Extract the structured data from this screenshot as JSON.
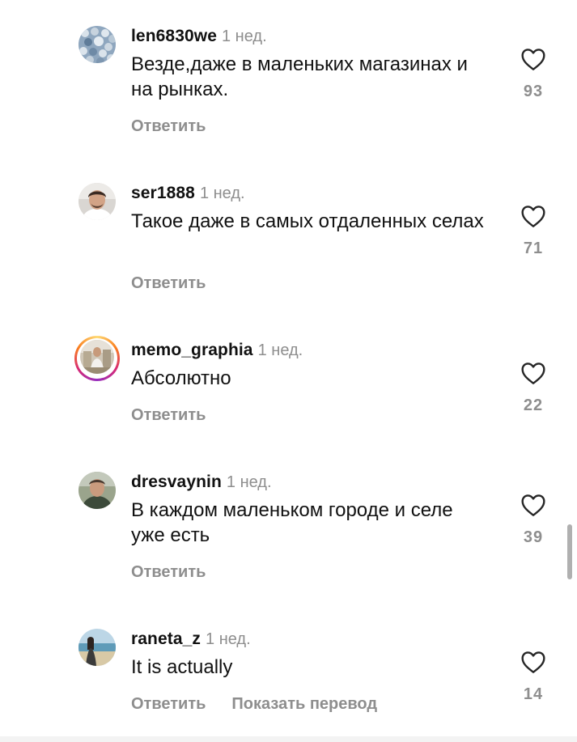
{
  "comments": [
    {
      "username": "len6830we",
      "time": "1 нед.",
      "text": "Везде,даже в маленьких магазинах и на рынках.",
      "reply_label": "Ответить",
      "likes": "93",
      "avatar": "knitted-texture-avatar"
    },
    {
      "username": "ser1888",
      "time": "1 нед.",
      "text": "Такое даже в самых отдаленных селах",
      "reply_label": "Ответить",
      "likes": "71",
      "avatar": "man-portrait-avatar"
    },
    {
      "username": "memo_graphia",
      "time": "1 нед.",
      "text": "Абсолютно",
      "reply_label": "Ответить",
      "likes": "22",
      "avatar": "story-ring-avatar"
    },
    {
      "username": "dresvaynin",
      "time": "1 нед.",
      "text": "В каждом маленьком городе и селе уже есть",
      "reply_label": "Ответить",
      "likes": "39",
      "avatar": "man-outdoor-avatar"
    },
    {
      "username": "raneta_z",
      "time": "1 нед.",
      "text": "It is actually",
      "reply_label": "Ответить",
      "translate_label": "Показать перевод",
      "likes": "14",
      "avatar": "beach-avatar"
    }
  ],
  "colors": {
    "text": "#111111",
    "secondary": "#8e8e8e"
  }
}
